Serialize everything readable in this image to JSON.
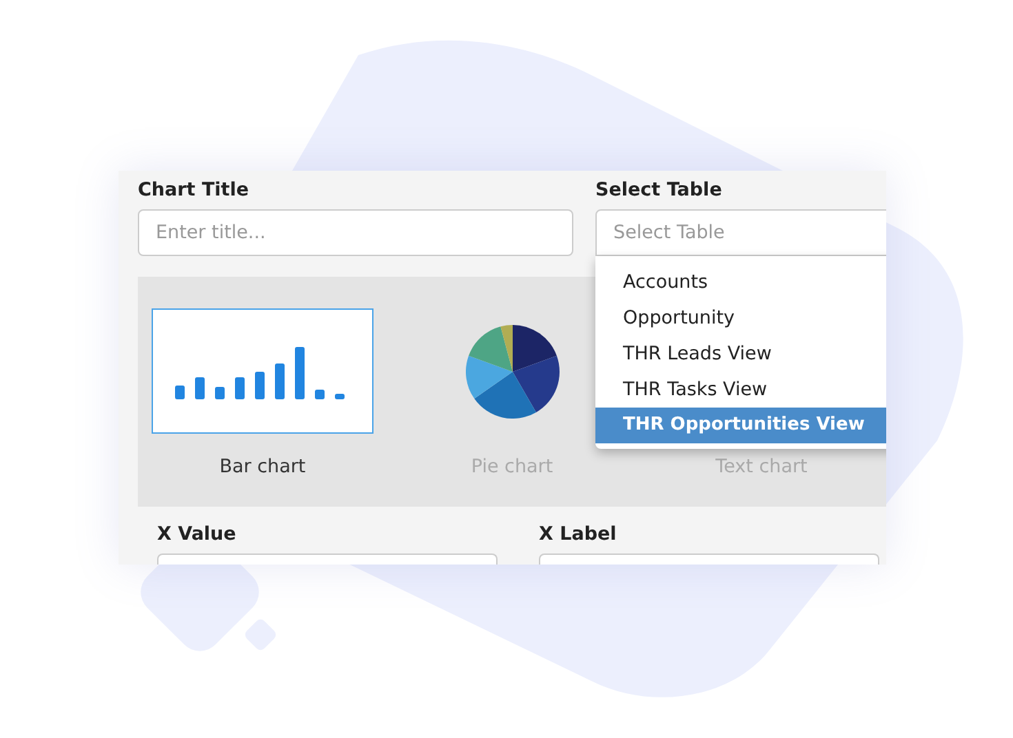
{
  "form": {
    "chart_title": {
      "label": "Chart Title",
      "placeholder": "Enter title..."
    },
    "table": {
      "label": "Select Table",
      "placeholder": "Select Table",
      "expanded": true,
      "options": [
        {
          "label": "Accounts",
          "selected": false
        },
        {
          "label": "Opportunity",
          "selected": false
        },
        {
          "label": "THR Leads View",
          "selected": false
        },
        {
          "label": "THR Tasks View",
          "selected": false
        },
        {
          "label": "THR Opportunities View",
          "selected": true
        }
      ]
    }
  },
  "chart_types": [
    {
      "kind": "bar",
      "label": "Bar chart",
      "selected": true
    },
    {
      "kind": "pie",
      "label": "Pie chart",
      "selected": false
    },
    {
      "kind": "text",
      "label": "Text chart",
      "selected": false
    }
  ],
  "x_value": {
    "label": "X Value"
  },
  "x_label": {
    "label": "X Label"
  }
}
